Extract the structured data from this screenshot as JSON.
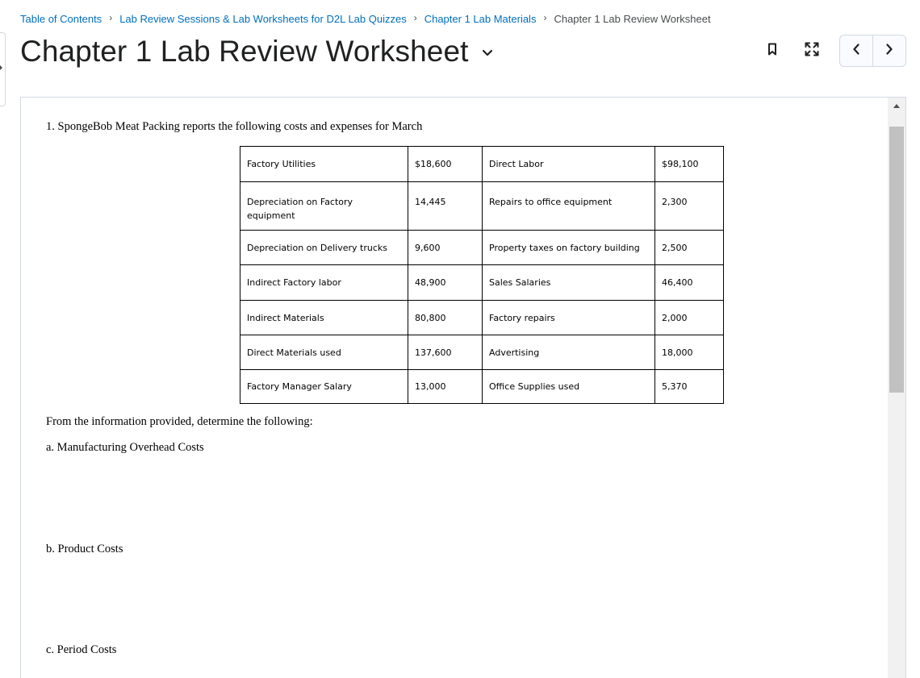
{
  "breadcrumb": {
    "items": [
      "Table of Contents",
      "Lab Review Sessions & Lab Worksheets for D2L Lab Quizzes",
      "Chapter 1 Lab Materials"
    ],
    "current": "Chapter 1 Lab Review Worksheet",
    "separator": "›"
  },
  "title": "Chapter 1 Lab Review Worksheet",
  "toolbar": {
    "icons": [
      "bookmark-icon",
      "fullscreen-icon",
      "chevron-left-icon",
      "chevron-right-icon"
    ]
  },
  "content": {
    "question": "1. SpongeBob Meat Packing reports the following costs and expenses for March",
    "table": {
      "rows": [
        [
          "Factory Utilities",
          "$18,600",
          "Direct Labor",
          "$98,100"
        ],
        [
          "Depreciation on Factory equipment",
          "14,445",
          "Repairs to office equipment",
          "2,300"
        ],
        [
          "Depreciation on Delivery trucks",
          "9,600",
          "Property taxes on factory building",
          "2,500"
        ],
        [
          "Indirect Factory labor",
          "48,900",
          "Sales Salaries",
          "46,400"
        ],
        [
          "Indirect Materials",
          "80,800",
          "Factory repairs",
          "2,000"
        ],
        [
          "Direct Materials used",
          "137,600",
          "Advertising",
          "18,000"
        ],
        [
          "Factory Manager Salary",
          "13,000",
          "Office Supplies used",
          "5,370"
        ]
      ]
    },
    "prompt": "From the information provided, determine the following:",
    "parts": {
      "a": "a. Manufacturing Overhead Costs",
      "b": "b. Product Costs",
      "c": "c. Period Costs"
    }
  },
  "colors": {
    "link": "#006fbf",
    "text": "#202122",
    "border": "#d3d9e3",
    "scroll_thumb": "#c1c1c1"
  }
}
